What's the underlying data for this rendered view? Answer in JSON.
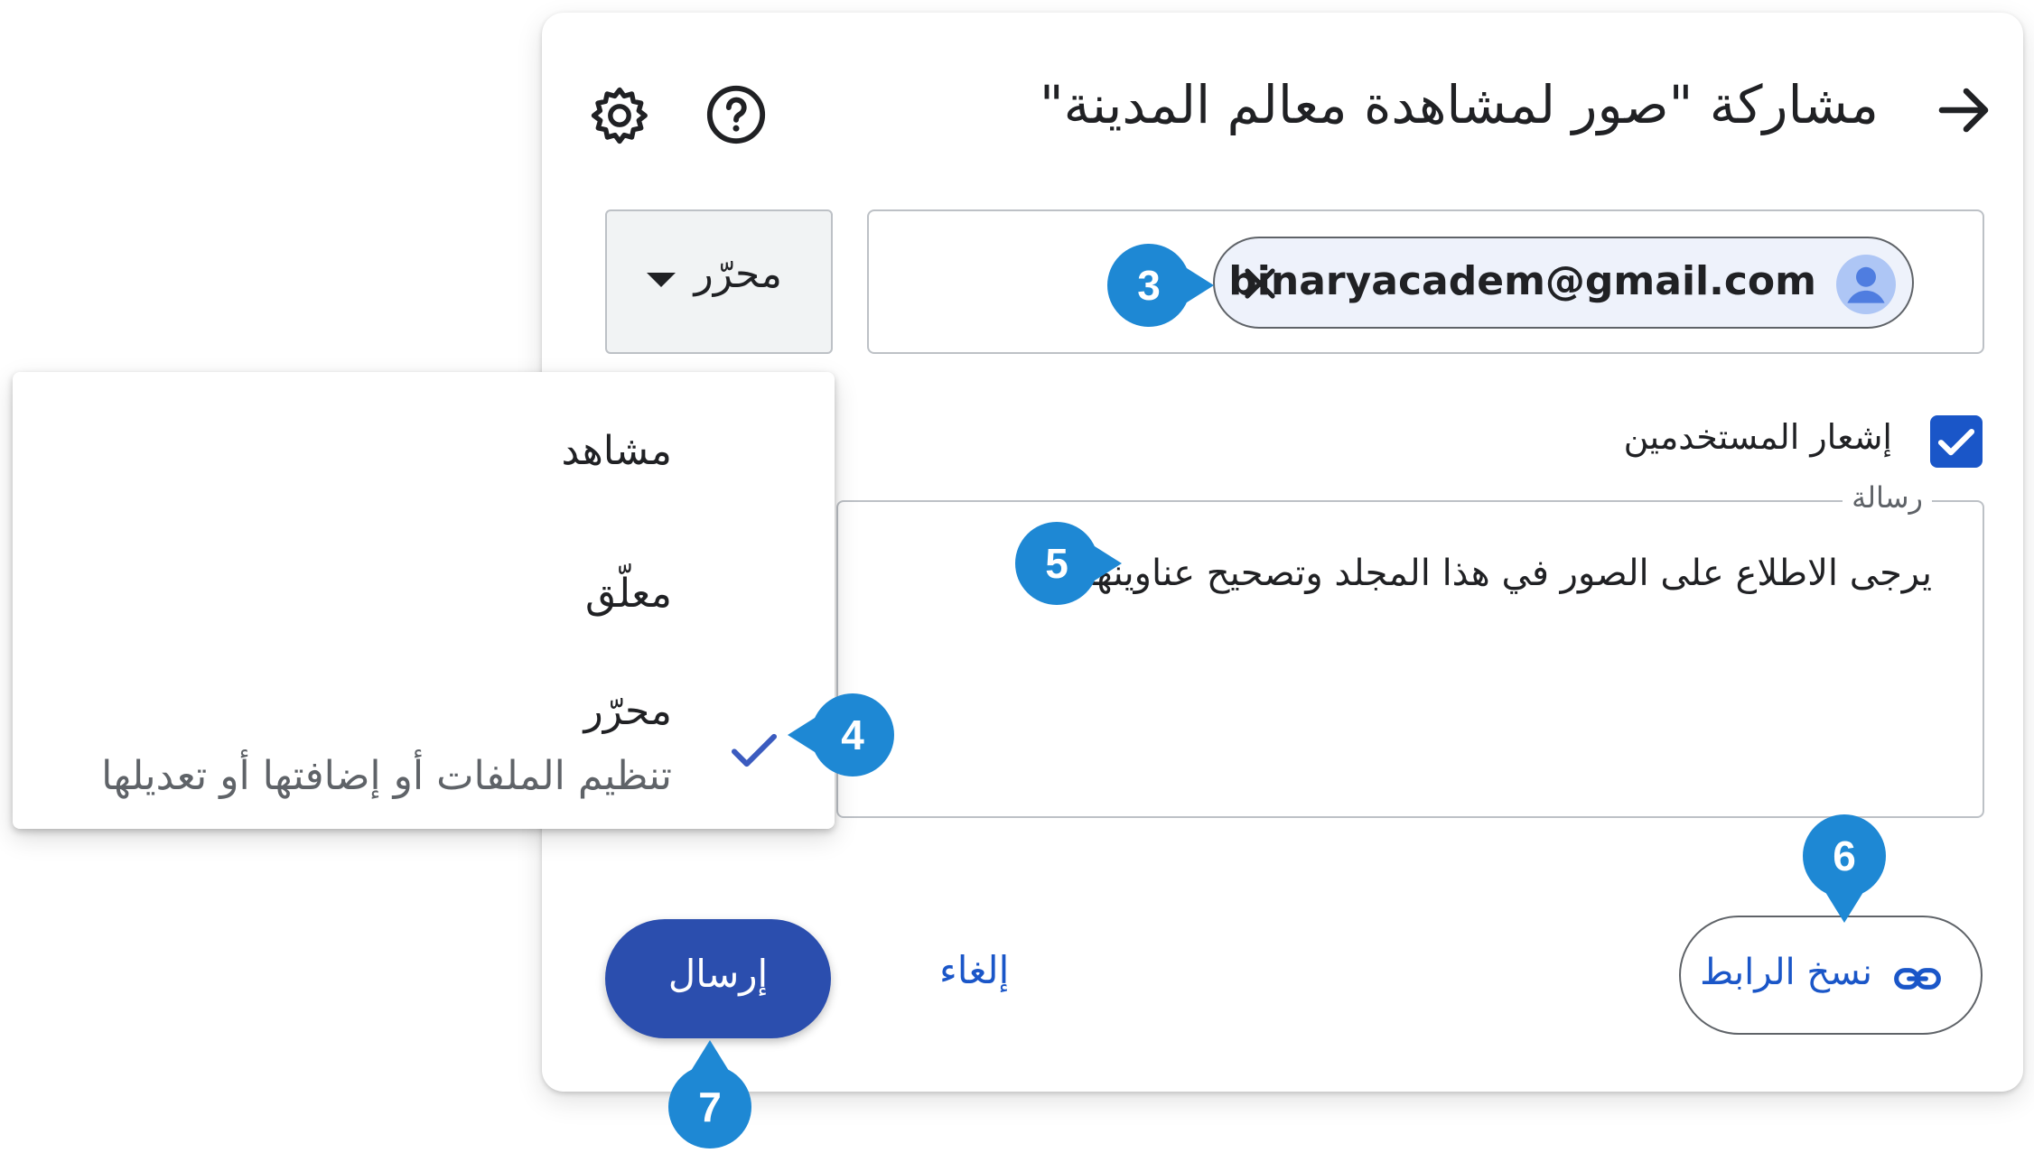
{
  "dialog": {
    "title": "مشاركة \"صور لمشاهدة معالم المدينة\"",
    "back_icon": "arrow-right-icon",
    "help_icon": "help-circle-icon",
    "settings_icon": "gear-icon"
  },
  "role_select": {
    "value": "محرّر"
  },
  "recipients": {
    "chips": [
      {
        "email": "binaryacadem@gmail.com"
      }
    ]
  },
  "notify": {
    "label": "إشعار المستخدمين",
    "checked": true
  },
  "message": {
    "legend": "رسالة",
    "text": "يرجى الاطلاع على الصور في هذا المجلد وتصحيح عناوينها."
  },
  "buttons": {
    "copy_link": "نسخ الرابط",
    "cancel": "إلغاء",
    "send": "إرسال"
  },
  "role_menu": {
    "items": [
      {
        "label": "مشاهد"
      },
      {
        "label": "معلّق"
      },
      {
        "label": "محرّر",
        "selected": true,
        "description": "تنظيم الملفات أو إضافتها أو تعديلها"
      }
    ]
  },
  "callouts": [
    "3",
    "4",
    "5",
    "6",
    "7"
  ],
  "colors": {
    "accent": "#1a56c8",
    "send_button": "#2b4eae",
    "callout": "#1e88d4"
  }
}
